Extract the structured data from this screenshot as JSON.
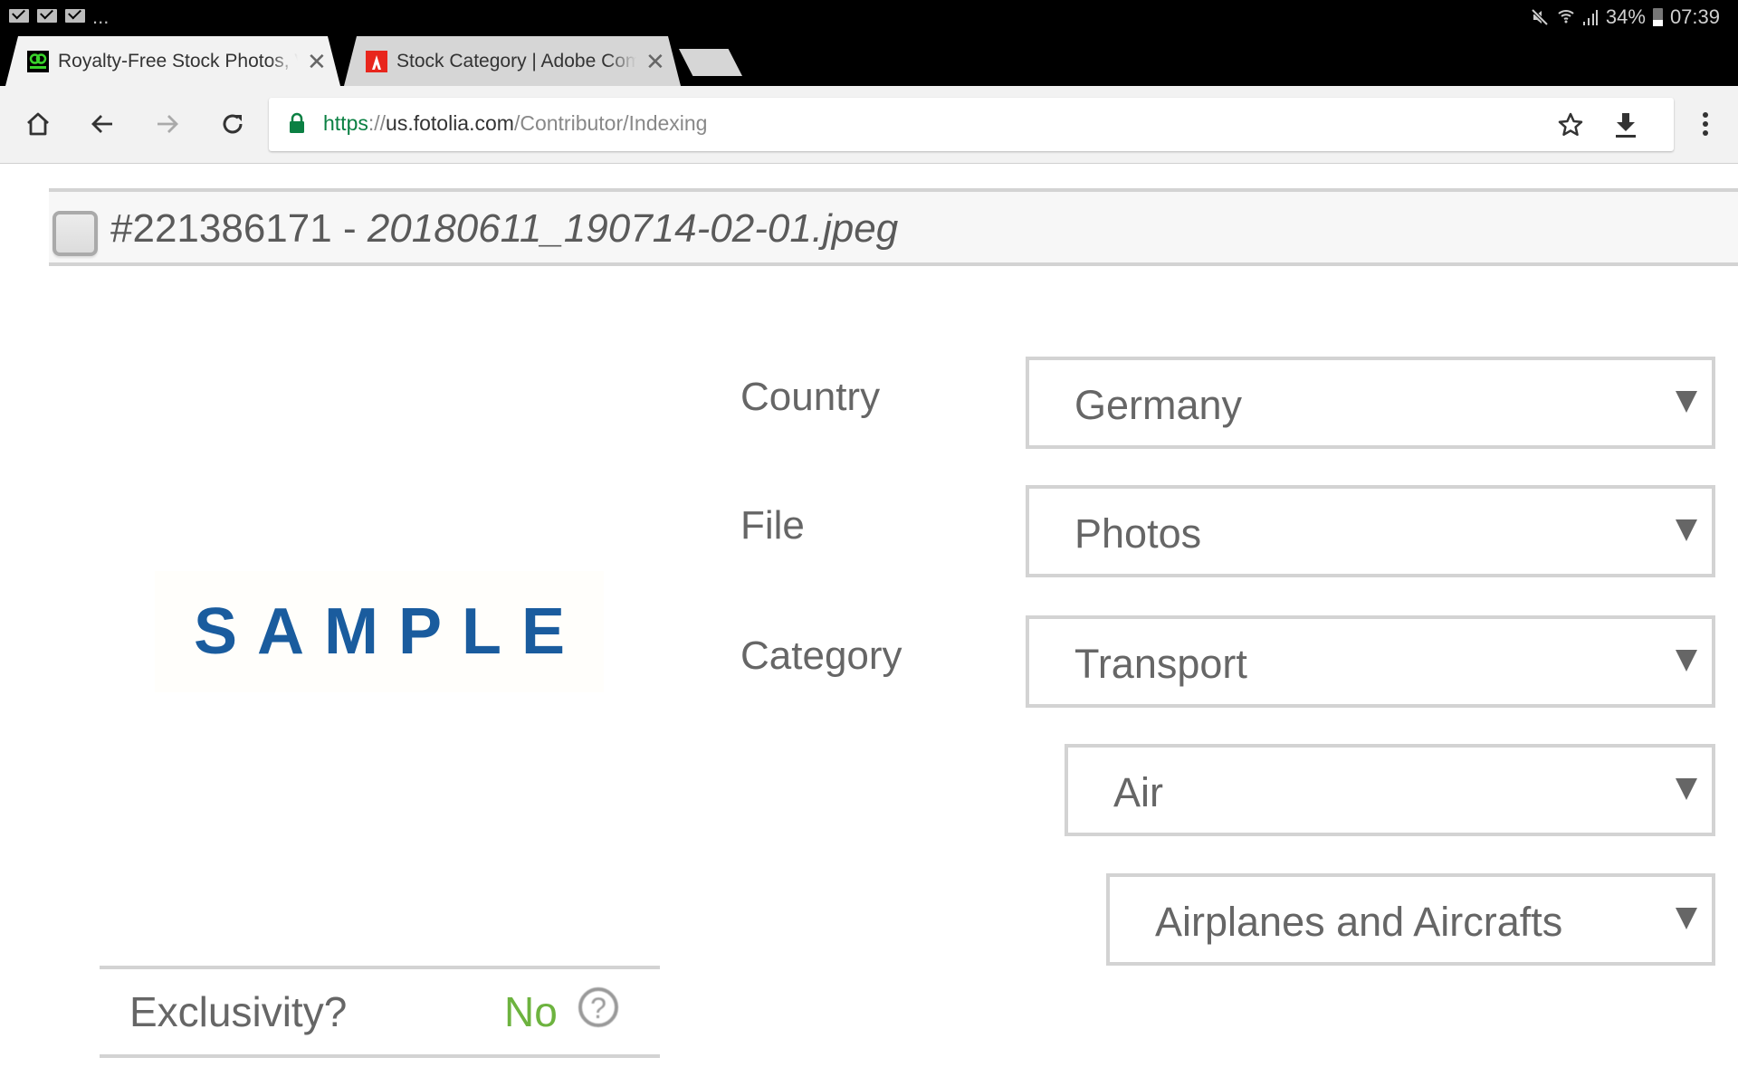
{
  "status_bar": {
    "notifications": [
      "mail-icon",
      "mail-icon",
      "mail-icon"
    ],
    "overflow": "...",
    "icons": [
      "mute-icon",
      "wifi-icon",
      "signal-icon"
    ],
    "battery": "34%",
    "time": "07:39"
  },
  "tabs": [
    {
      "title": "Royalty-Free Stock Photos, Vectors",
      "favicon": "fotolia-favicon",
      "active": true
    },
    {
      "title": "Stock Category | Adobe Community",
      "favicon": "adobe-favicon",
      "active": false
    }
  ],
  "toolbar": {
    "url": {
      "scheme": "https",
      "separator": "://",
      "host": "us.fotolia.com",
      "path": "/Contributor/Indexing"
    }
  },
  "item": {
    "id": "#221386171",
    "separator": " - ",
    "filename": "20180611_190714-02-01.jpeg",
    "preview_text": "SAMPLE"
  },
  "form": {
    "country": {
      "label": "Country",
      "value": "Germany"
    },
    "file": {
      "label": "File",
      "value": "Photos"
    },
    "category": {
      "label": "Category",
      "value": "Transport"
    },
    "subcategory": {
      "value": "Air"
    },
    "subsubcategory": {
      "value": "Airplanes and Aircrafts"
    }
  },
  "exclusivity": {
    "label": "Exclusivity?",
    "value": "No",
    "help": "?"
  },
  "colors": {
    "url_scheme": "#0b8043",
    "exclusivity_value": "#6db33f",
    "sample_text": "#1a5c9e"
  }
}
